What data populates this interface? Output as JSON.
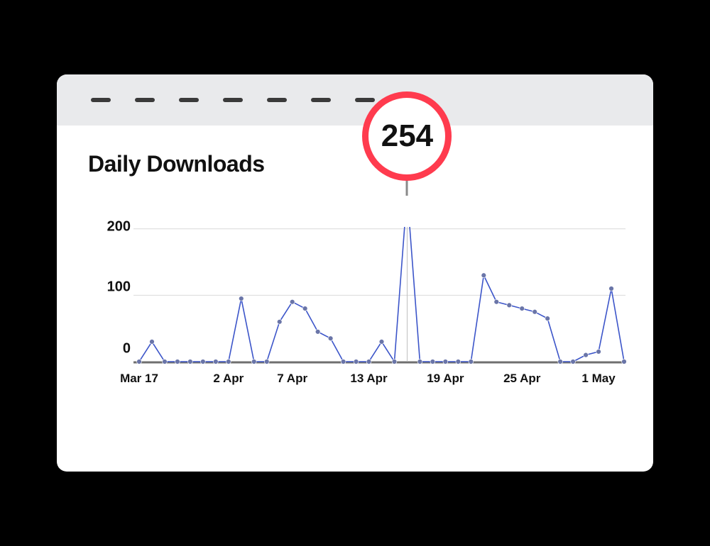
{
  "title": "Daily Downloads",
  "callout_value": "254",
  "y_ticks": [
    "0",
    "100",
    "200"
  ],
  "x_ticks": [
    "Mar 17",
    "2 Apr",
    "7 Apr",
    "13 Apr",
    "19 Apr",
    "25 Apr",
    "1 May"
  ],
  "colors": {
    "accent": "#ff3b4e",
    "line": "#3c55c9",
    "point": "#6a75a8",
    "grid": "#d9d9d9",
    "axis": "#6f6f6f"
  },
  "chart_data": {
    "type": "line",
    "title": "Daily Downloads",
    "xlabel": "",
    "ylabel": "",
    "ylim": [
      0,
      220
    ],
    "x_tick_labels": [
      "Mar 17",
      "2 Apr",
      "7 Apr",
      "13 Apr",
      "19 Apr",
      "25 Apr",
      "1 May"
    ],
    "series": [
      {
        "name": "downloads",
        "x_index": [
          0,
          1,
          2,
          3,
          4,
          5,
          6,
          7,
          8,
          9,
          10,
          11,
          12,
          13,
          14,
          15,
          16,
          17,
          18,
          19,
          20,
          21,
          22,
          23,
          24,
          25,
          26,
          27,
          28,
          29,
          30,
          31,
          32,
          33,
          34,
          35,
          36,
          37,
          38
        ],
        "values": [
          0,
          30,
          0,
          0,
          0,
          0,
          0,
          0,
          95,
          0,
          0,
          60,
          90,
          80,
          45,
          35,
          0,
          0,
          0,
          30,
          0,
          254,
          0,
          0,
          0,
          0,
          0,
          130,
          90,
          85,
          80,
          75,
          65,
          0,
          0,
          10,
          15,
          110,
          0
        ]
      }
    ],
    "highlight": {
      "x_index": 21,
      "value": 254
    }
  }
}
